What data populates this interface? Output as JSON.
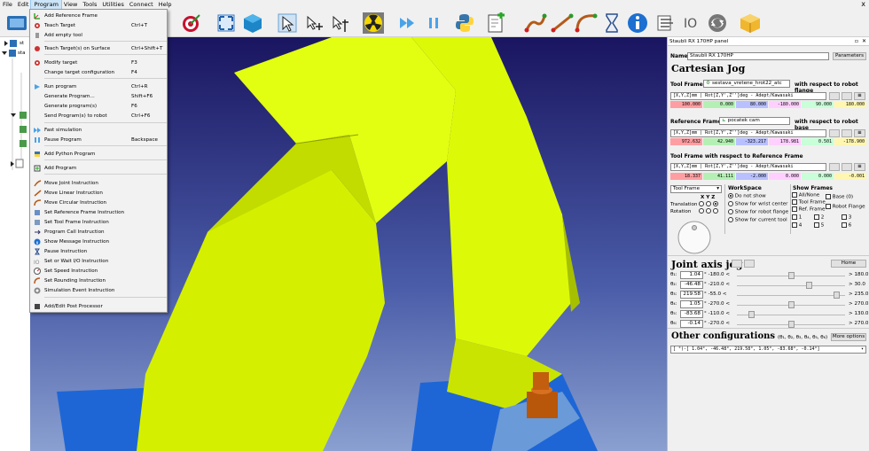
{
  "menubar": {
    "items": [
      "File",
      "Edit",
      "Program",
      "View",
      "Tools",
      "Utilities",
      "Connect",
      "Help"
    ],
    "close": "x"
  },
  "toolbar": {
    "icons": [
      "robodk-logo-icon",
      "robot-icon",
      "target-icon",
      "fit-all-icon",
      "box-view-icon",
      "select-icon",
      "move-reference-icon",
      "move-tool-icon",
      "collision-icon",
      "fast-forward-icon",
      "pause-icon",
      "python-icon",
      "add-program-icon",
      "move-joint-icon",
      "move-linear-icon",
      "move-circular-icon",
      "hourglass-icon",
      "info-icon",
      "set-tool-icon",
      "io-icon",
      "refresh-icon",
      "package-icon"
    ]
  },
  "program_menu": {
    "items": [
      {
        "label": "Add Reference Frame",
        "shortcut": "",
        "icon": "reference-frame-icon"
      },
      {
        "label": "Teach Target",
        "shortcut": "Ctrl+T",
        "icon": "teach-target-icon"
      },
      {
        "label": "Add empty tool",
        "shortcut": "",
        "icon": "empty-tool-icon"
      },
      {
        "label": "Teach Target(s) on Surface",
        "shortcut": "Ctrl+Shift+T",
        "icon": "surface-target-icon"
      },
      {
        "label": "Modify target",
        "shortcut": "F3",
        "icon": "modify-target-icon"
      },
      {
        "label": "Change target configuration",
        "shortcut": "F4",
        "icon": ""
      },
      {
        "label": "Run program",
        "shortcut": "Ctrl+R",
        "icon": "run-program-icon"
      },
      {
        "label": "Generate Program...",
        "shortcut": "Shift+F6",
        "icon": ""
      },
      {
        "label": "Generate program(s)",
        "shortcut": "F6",
        "icon": ""
      },
      {
        "label": "Send Program(s) to robot",
        "shortcut": "Ctrl+F6",
        "icon": ""
      },
      {
        "label": "Fast simulation",
        "shortcut": "",
        "icon": "fast-simulation-icon"
      },
      {
        "label": "Pause Program",
        "shortcut": "Backspace",
        "icon": "pause-program-icon"
      },
      {
        "label": "Add Python Program",
        "shortcut": "",
        "icon": "python-program-icon"
      },
      {
        "label": "Add Program",
        "shortcut": "",
        "icon": "add-program-icon"
      },
      {
        "label": "Move Joint Instruction",
        "shortcut": "",
        "icon": "move-joint-icon"
      },
      {
        "label": "Move Linear Instruction",
        "shortcut": "",
        "icon": "move-linear-icon"
      },
      {
        "label": "Move Circular Instruction",
        "shortcut": "",
        "icon": "move-circular-icon"
      },
      {
        "label": "Set Reference Frame Instruction",
        "shortcut": "",
        "icon": "set-reference-icon"
      },
      {
        "label": "Set Tool Frame Instruction",
        "shortcut": "",
        "icon": "set-tool-icon"
      },
      {
        "label": "Program Call Instruction",
        "shortcut": "",
        "icon": "program-call-icon"
      },
      {
        "label": "Show Message Instruction",
        "shortcut": "",
        "icon": "message-icon"
      },
      {
        "label": "Pause Instruction",
        "shortcut": "",
        "icon": "pause-instruction-icon"
      },
      {
        "label": "Set or Wait I/O Instruction",
        "shortcut": "",
        "icon": "io-icon"
      },
      {
        "label": "Set Speed Instruction",
        "shortcut": "",
        "icon": "speed-icon"
      },
      {
        "label": "Set Rounding Instruction",
        "shortcut": "",
        "icon": "rounding-icon"
      },
      {
        "label": "Simulation Event Instruction",
        "shortcut": "",
        "icon": "event-icon"
      },
      {
        "label": "Add/Edit Post Processor",
        "shortcut": "",
        "icon": "post-processor-icon"
      }
    ]
  },
  "panel": {
    "title": "Staubli RX 170HP panel",
    "name_label": "Name:",
    "name_value": "Staubli RX 170HP",
    "parameters_button": "Parameters",
    "cartesian_heading": "Cartesian Jog",
    "tool_frame_label": "Tool Frame",
    "tool_frame_value": "sestava_vretene_hrot22_atc",
    "wrt_flange": "with respect to robot flange",
    "format_1": "[X,Y,Z]mm | Rot[Z,Y',Z'']deg - Adept/Kawasaki",
    "tool_values": [
      "100.000",
      "0.000",
      "80.000",
      "-180.000",
      "90.000",
      "180.000"
    ],
    "reference_frame_label": "Reference Frame",
    "reference_frame_value": "pocatek cam",
    "wrt_base": "with respect to robot base",
    "format_2": "[X,Y,Z]mm | Rot[Z,Y',Z'']deg - Adept/Kawasaki",
    "ref_values": [
      "972.632",
      "42.940",
      "-323.217",
      "178.981",
      "0.501",
      "-178.900"
    ],
    "tool_wrt_ref_heading": "Tool Frame with respect to Reference Frame",
    "format_3": "[X,Y,Z]mm | Rot[Z,Y',Z'']deg - Adept/Kawasaki",
    "tool_ref_values": [
      "18.337",
      "41.111",
      "-2.000",
      "0.000",
      "0.000",
      "-0.001"
    ],
    "jog_select": "Tool Frame",
    "xyz_header": "X  Y  Z",
    "translation_label": "Translation",
    "rotation_label": "Rotation",
    "workspace_heading": "WorkSpace",
    "workspace_options": [
      "Do not show",
      "Show for wrist center",
      "Show for robot flange",
      "Show for current tool"
    ],
    "show_frames_heading": "Show Frames",
    "frame_options": [
      "All/None",
      "Base (0)",
      "Tool Frame",
      "Robot Flange",
      "Ref. Frame",
      "1",
      "2",
      "3",
      "4",
      "5",
      "6"
    ],
    "joint_heading": "Joint axis jog",
    "home_button": "Home",
    "joints": [
      {
        "label": "θ₁:",
        "value": "1.04",
        "min": "-180.0",
        "max": "180.0",
        "fraction": 0.503
      },
      {
        "label": "θ₂:",
        "value": "-46.48",
        "min": "-210.0",
        "max": "30.0",
        "fraction": 0.681
      },
      {
        "label": "θ₃:",
        "value": "219.58",
        "min": "-55.0",
        "max": "235.0",
        "fraction": 0.947
      },
      {
        "label": "θ₄:",
        "value": "1.05",
        "min": "-270.0",
        "max": "270.0",
        "fraction": 0.502
      },
      {
        "label": "θ₅:",
        "value": "-83.68",
        "min": "-110.0",
        "max": "130.0",
        "fraction": 0.11
      },
      {
        "label": "θ₆:",
        "value": "-0.14",
        "min": "-270.0",
        "max": "270.0",
        "fraction": 0.5
      }
    ],
    "other_heading": "Other configurations",
    "other_sub": "(θ₁, θ₂, θ₃, θ₄, θ₅, θ₆)",
    "more_options_button": "More options",
    "config_value": "[ °)-[  1.04°,  -46.48°,  219.58°,   1.05°,  -83.68°,  -0.14°]"
  },
  "tree": {
    "labels": [
      "st",
      "sta"
    ]
  }
}
